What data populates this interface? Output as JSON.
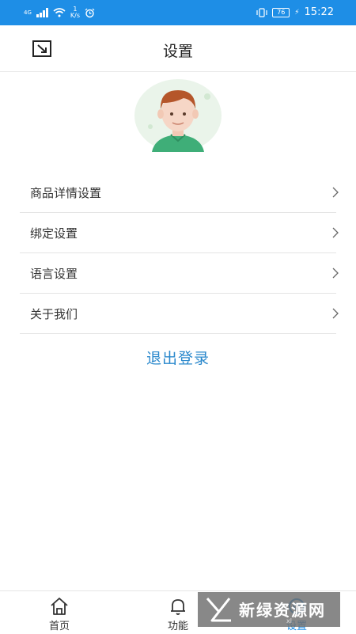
{
  "status_bar": {
    "signal": "4G",
    "speed_value": "1",
    "speed_unit": "K/s",
    "battery": "76",
    "time": "15:22"
  },
  "header": {
    "title": "设置",
    "left_icon": "expand-icon"
  },
  "profile": {
    "avatar_icon": "user-avatar"
  },
  "menu": {
    "items": [
      {
        "label": "商品详情设置"
      },
      {
        "label": "绑定设置"
      },
      {
        "label": "语言设置"
      },
      {
        "label": "关于我们"
      }
    ]
  },
  "logout_label": "退出登录",
  "tabbar": {
    "tabs": [
      {
        "label": "首页",
        "icon": "home-icon"
      },
      {
        "label": "功能",
        "icon": "bell-icon"
      },
      {
        "label": "设置",
        "icon": "settings-icon",
        "active": true
      }
    ]
  },
  "watermark": {
    "text": "新绿资源网",
    "sub": "xl"
  },
  "colors": {
    "accent": "#1e8ee6",
    "link": "#2a88cc"
  }
}
